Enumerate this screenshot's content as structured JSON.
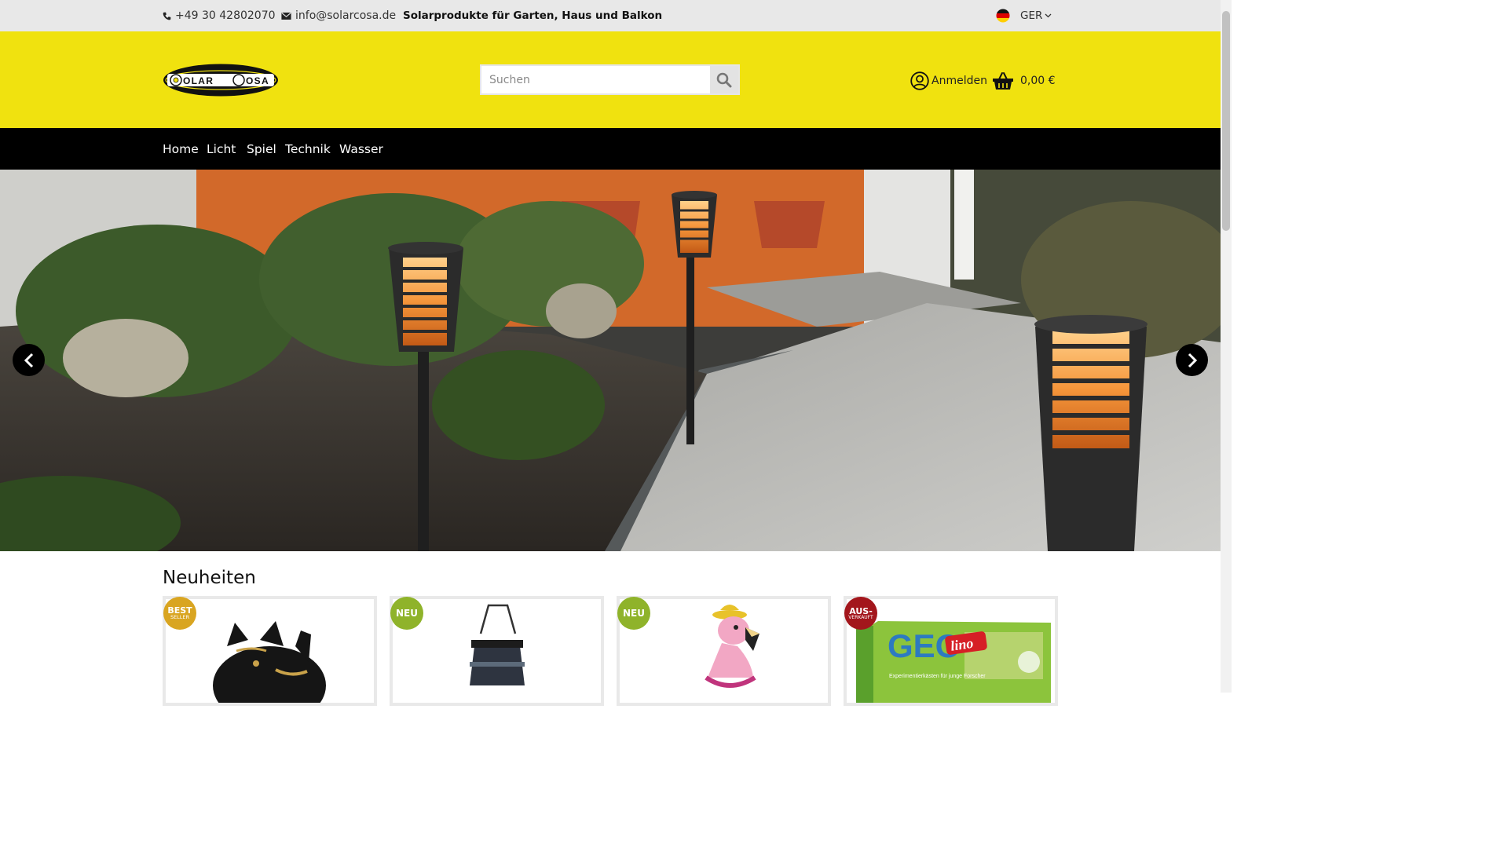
{
  "topbar": {
    "phone": "+49 30 42802070",
    "email": "info@solarcosa.de",
    "tagline": "Solarprodukte für Garten, Haus und Balkon",
    "language": "GER"
  },
  "header": {
    "logo_text": "SOLARCOSA",
    "search_placeholder": "Suchen",
    "login_label": "Anmelden",
    "cart_total": "0,00 €"
  },
  "nav": {
    "items": [
      "Home",
      "Licht",
      "Spiel",
      "Technik",
      "Wasser"
    ]
  },
  "section": {
    "title": "Neuheiten"
  },
  "products": [
    {
      "badge_line1": "BEST",
      "badge_line2": "SELLER",
      "badge_color": "#d9a521"
    },
    {
      "badge_line1": "NEU",
      "badge_line2": "",
      "badge_color": "#8fb32a"
    },
    {
      "badge_line1": "NEU",
      "badge_line2": "",
      "badge_color": "#8fb32a"
    },
    {
      "badge_line1": "AUS-",
      "badge_line2": "VERKAUFT",
      "badge_color": "#a3161c"
    }
  ],
  "product_images": {
    "geo_title": "GEO",
    "geo_brand": "lino",
    "geo_subtitle": "Experimentierkästen für junge Forscher"
  },
  "colors": {
    "header_yellow": "#f0e20f",
    "nav_black": "#000000",
    "topbar_grey": "#e8e8e8"
  }
}
